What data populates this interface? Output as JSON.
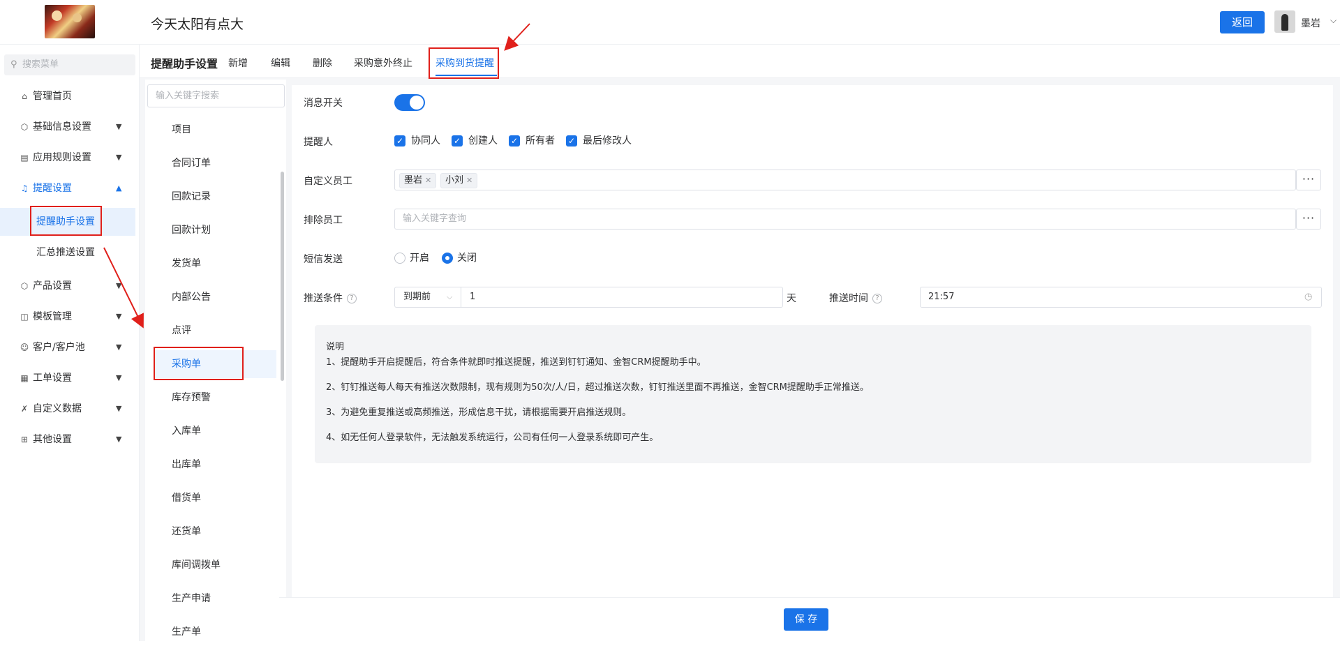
{
  "app": {
    "title": "今天太阳有点大",
    "back_label": "返回",
    "username": "墨岩"
  },
  "sidebar": {
    "search_placeholder": "搜索菜单",
    "items": [
      {
        "label": "管理首页",
        "icon": "home-icon"
      },
      {
        "label": "基础信息设置",
        "icon": "cube-icon"
      },
      {
        "label": "应用规则设置",
        "icon": "document-icon"
      },
      {
        "label": "提醒设置",
        "icon": "bell-icon"
      },
      {
        "label": "产品设置",
        "icon": "cube-icon"
      },
      {
        "label": "模板管理",
        "icon": "template-icon"
      },
      {
        "label": "客户/客户池",
        "icon": "user-icon"
      },
      {
        "label": "工单设置",
        "icon": "form-icon"
      },
      {
        "label": "自定义数据",
        "icon": "tools-icon"
      },
      {
        "label": "其他设置",
        "icon": "grid-icon"
      }
    ],
    "subitems": [
      {
        "label": "提醒助手设置"
      },
      {
        "label": "汇总推送设置"
      }
    ]
  },
  "header": {
    "title": "提醒助手设置",
    "tabs": [
      {
        "label": "新增"
      },
      {
        "label": "编辑"
      },
      {
        "label": "删除"
      },
      {
        "label": "采购意外终止"
      },
      {
        "label": "采购到货提醒"
      }
    ]
  },
  "list": {
    "search_placeholder": "输入关键字搜索",
    "items": [
      {
        "label": "项目"
      },
      {
        "label": "合同订单"
      },
      {
        "label": "回款记录"
      },
      {
        "label": "回款计划"
      },
      {
        "label": "发货单"
      },
      {
        "label": "内部公告"
      },
      {
        "label": "点评"
      },
      {
        "label": "采购单"
      },
      {
        "label": "库存预警"
      },
      {
        "label": "入库单"
      },
      {
        "label": "出库单"
      },
      {
        "label": "借货单"
      },
      {
        "label": "还货单"
      },
      {
        "label": "库间调拨单"
      },
      {
        "label": "生产申请"
      },
      {
        "label": "生产单"
      }
    ]
  },
  "form": {
    "switch_label": "消息开关",
    "switch_on": true,
    "reminder_label": "提醒人",
    "reminders": [
      {
        "label": "协同人",
        "checked": true
      },
      {
        "label": "创建人",
        "checked": true
      },
      {
        "label": "所有者",
        "checked": true
      },
      {
        "label": "最后修改人",
        "checked": true
      }
    ],
    "custom_label": "自定义员工",
    "custom_tags": [
      {
        "label": "墨岩"
      },
      {
        "label": "小刘"
      }
    ],
    "exclude_label": "排除员工",
    "exclude_placeholder": "输入关键字查询",
    "more_label": "···",
    "sms_label": "短信发送",
    "sms_options": [
      {
        "label": "开启",
        "selected": false
      },
      {
        "label": "关闭",
        "selected": true
      }
    ],
    "cond_label": "推送条件",
    "cond_select": "到期前",
    "cond_value": "1",
    "cond_unit": "天",
    "time_label": "推送时间",
    "time_value": "21:57"
  },
  "note": {
    "title": "说明",
    "lines": [
      "1、提醒助手开启提醒后，符合条件就即时推送提醒，推送到钉钉通知、金智CRM提醒助手中。",
      "2、钉钉推送每人每天有推送次数限制，现有规则为50次/人/日，超过推送次数，钉钉推送里面不再推送，金智CRM提醒助手正常推送。",
      "3、为避免重复推送或高频推送，形成信息干扰，请根据需要开启推送规则。",
      "4、如无任何人登录软件，无法触发系统运行，公司有任何一人登录系统即可产生。"
    ]
  },
  "footer": {
    "save_label": "保 存"
  },
  "colors": {
    "accent": "#1a73e8",
    "annotation_red": "#e0201b"
  }
}
